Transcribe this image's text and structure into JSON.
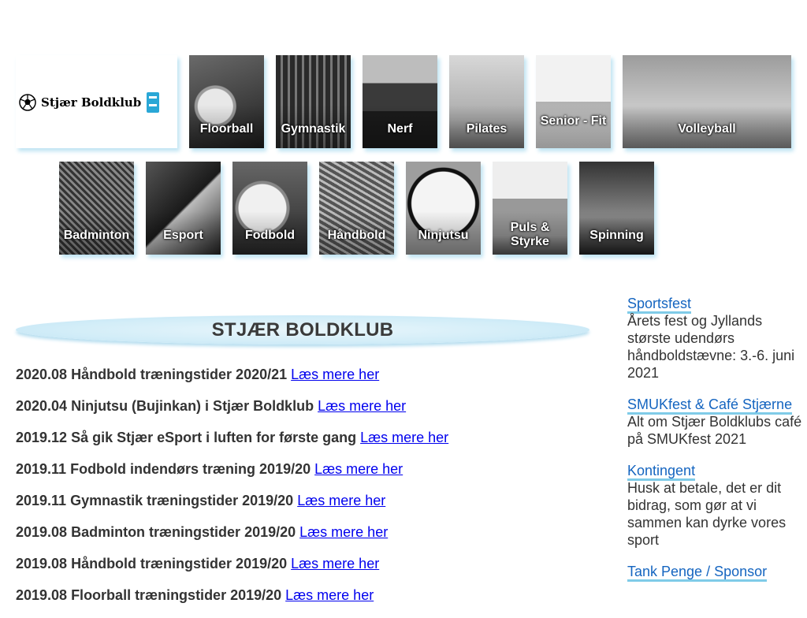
{
  "logo": {
    "text": "Stjær Boldklub"
  },
  "tiles_row1": [
    {
      "label": "Floorball"
    },
    {
      "label": "Gymnastik"
    },
    {
      "label": "Nerf"
    },
    {
      "label": "Pilates"
    },
    {
      "label": "Senior - Fit"
    },
    {
      "label": "Volleyball"
    }
  ],
  "tiles_row2": [
    {
      "label": "Badminton"
    },
    {
      "label": "Esport"
    },
    {
      "label": "Fodbold"
    },
    {
      "label": "Håndbold"
    },
    {
      "label": "Ninjutsu"
    },
    {
      "label": "Puls & Styrke"
    },
    {
      "label": "Spinning"
    }
  ],
  "banner": {
    "title": "STJÆR BOLDKLUB"
  },
  "news": [
    {
      "text": "2020.08 Håndbold træningstider 2020/21",
      "link": "Læs mere her"
    },
    {
      "text": "2020.04 Ninjutsu (Bujinkan) i Stjær Boldklub",
      "link": "Læs mere her"
    },
    {
      "text": "2019.12 Så gik Stjær eSport i luften for første gang",
      "link": "Læs mere her"
    },
    {
      "text": "2019.11 Fodbold indendørs træning 2019/20",
      "link": "Læs mere her"
    },
    {
      "text": "2019.11 Gymnastik træningstider 2019/20",
      "link": "Læs mere her"
    },
    {
      "text": "2019.08 Badminton træningstider 2019/20",
      "link": "Læs mere her"
    },
    {
      "text": "2019.08 Håndbold træningstider 2019/20",
      "link": "Læs mere her"
    },
    {
      "text": "2019.08 Floorball træningstider 2019/20",
      "link": "Læs mere her"
    }
  ],
  "sidebar": [
    {
      "title": "Sportsfest",
      "desc": "Årets fest og Jyllands største udendørs håndboldstævne: 3.-6. juni 2021"
    },
    {
      "title": "SMUKfest & Café Stjærne",
      "desc": "Alt om Stjær Boldklubs café på SMUKfest 2021"
    },
    {
      "title": "Kontingent",
      "desc": "Husk at betale, det er dit bidrag, som gør at vi sammen kan dyrke vores sport"
    },
    {
      "title": "Tank Penge / Sponsor",
      "desc": ""
    }
  ]
}
